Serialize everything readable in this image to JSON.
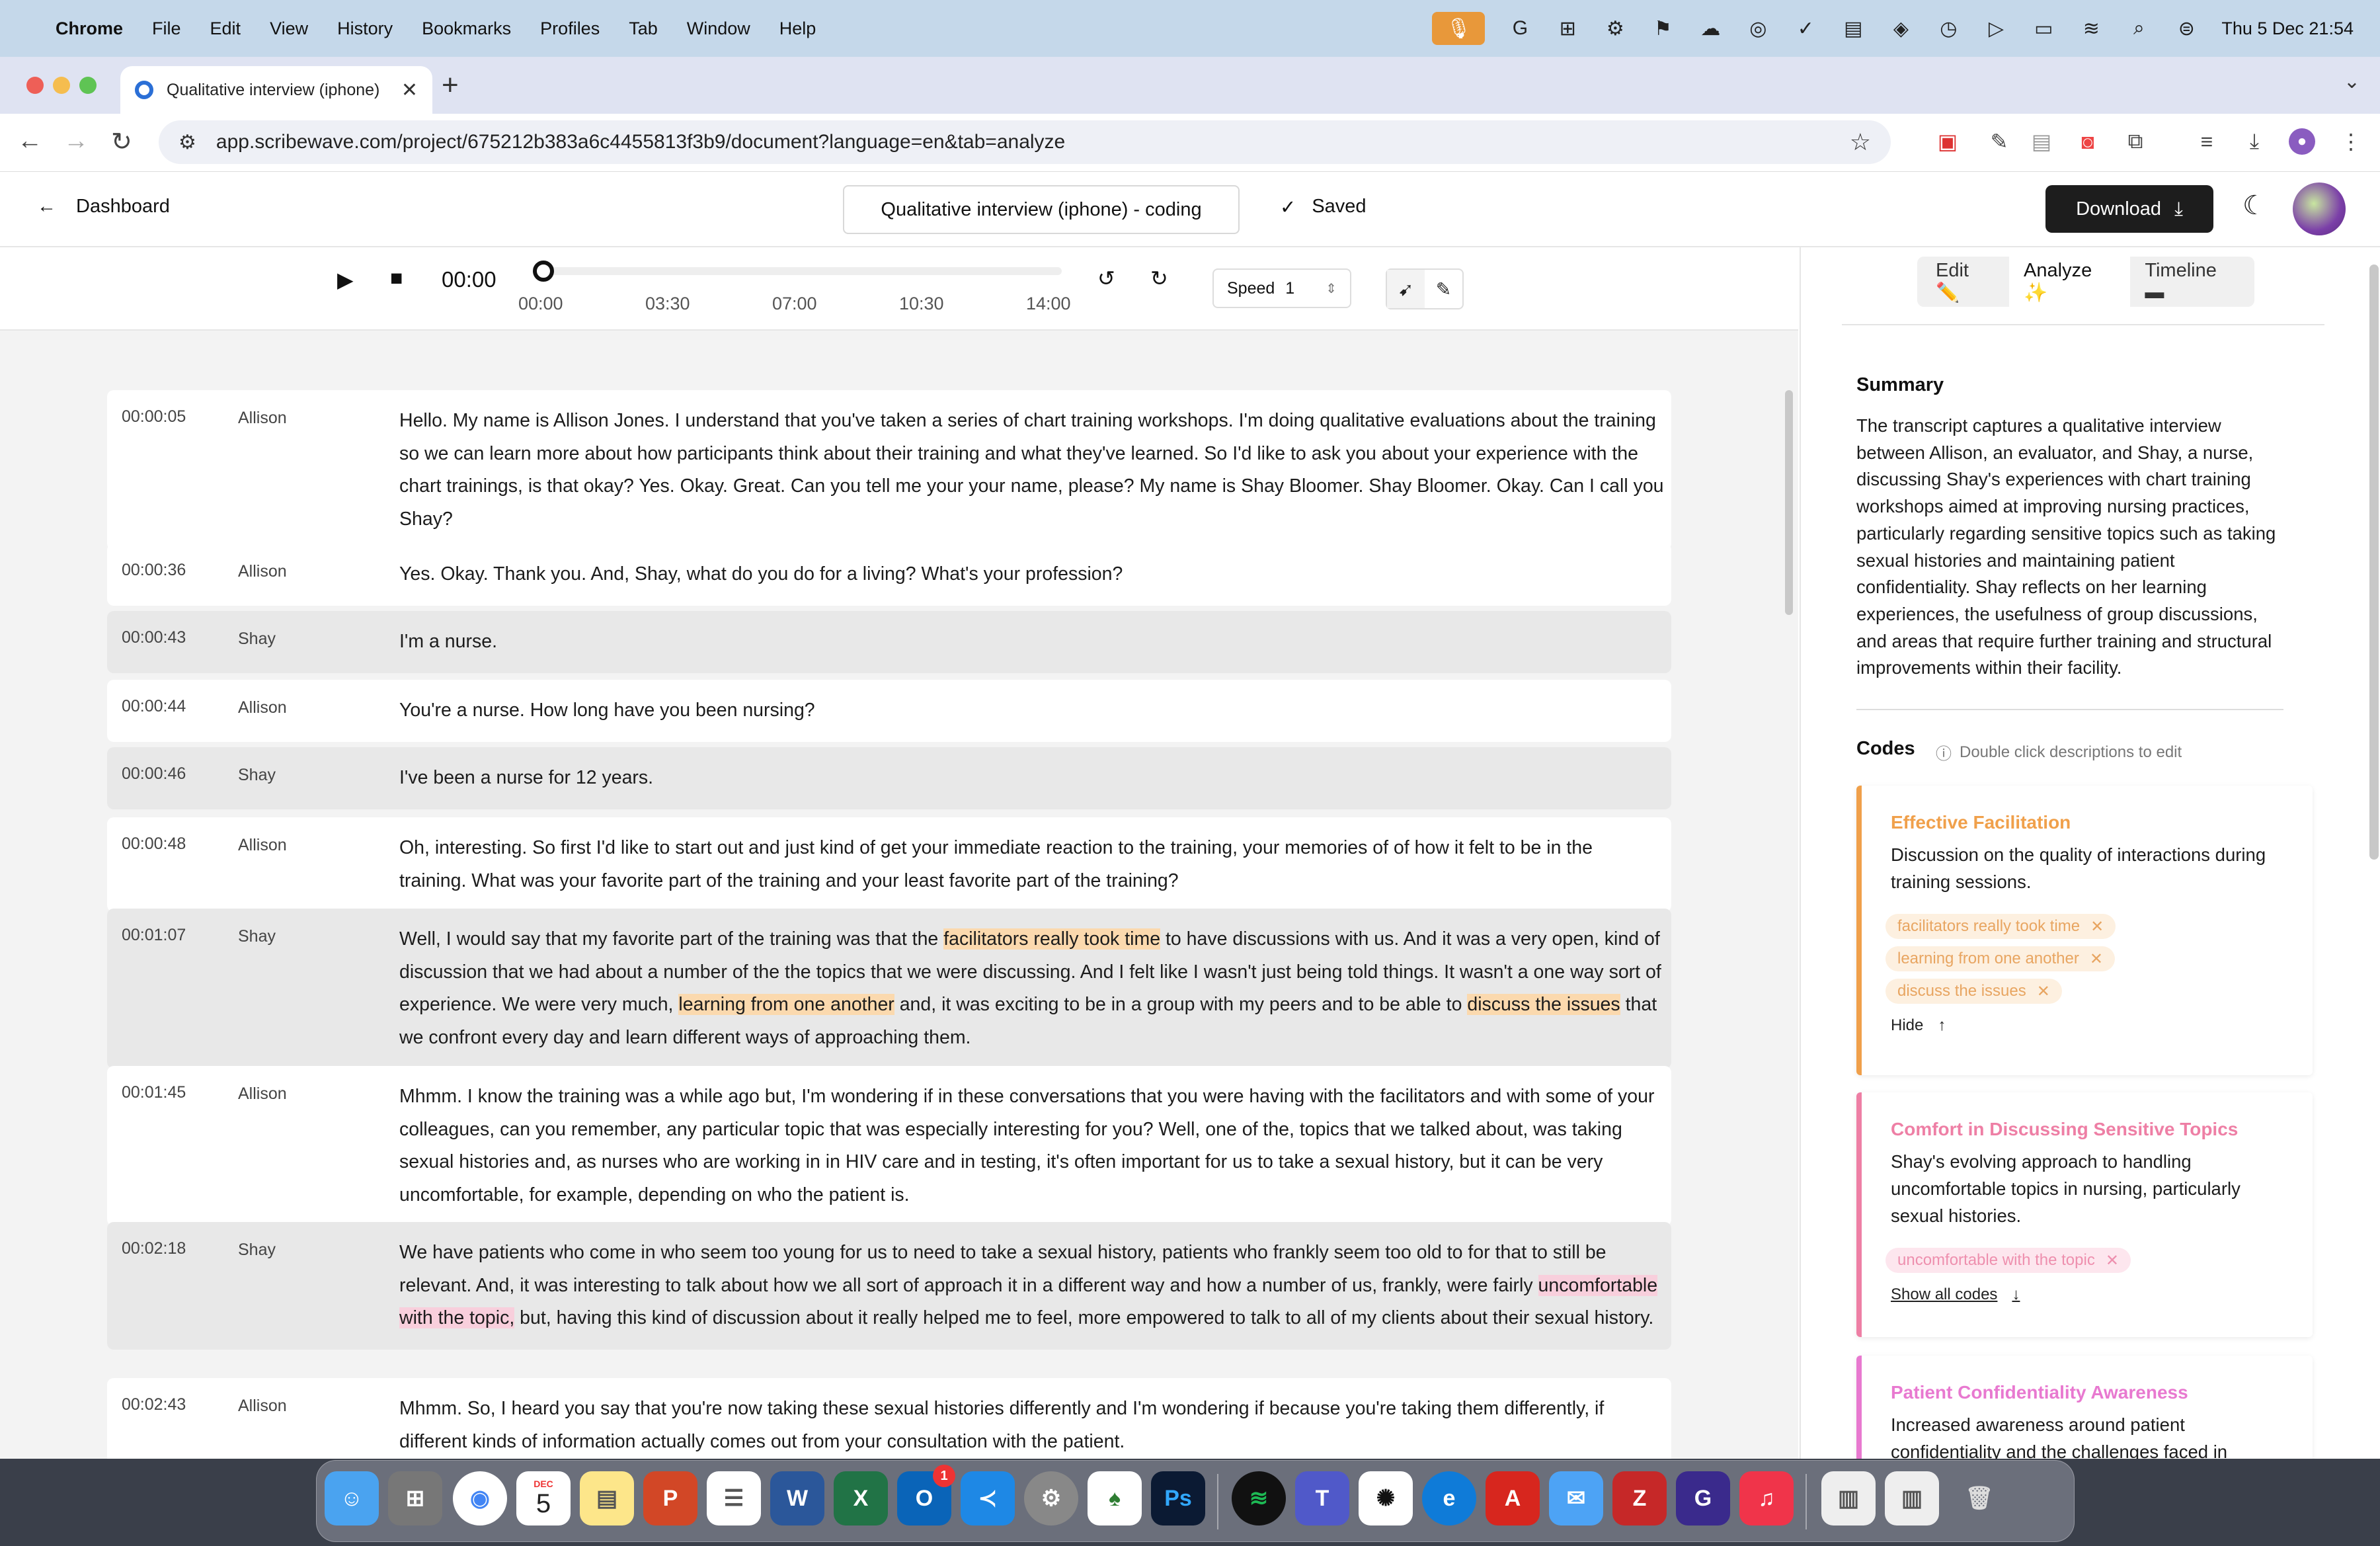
{
  "menubar": {
    "items": [
      "Chrome",
      "File",
      "Edit",
      "View",
      "History",
      "Bookmarks",
      "Profiles",
      "Tab",
      "Window",
      "Help"
    ],
    "datetime": "Thu 5 Dec  21:54"
  },
  "browser": {
    "tab_title": "Qualitative interview (iphone)",
    "url": "app.scribewave.com/project/675212b383a6c4455813f3b9/document?language=en&tab=analyze"
  },
  "app": {
    "back_label": "Dashboard",
    "doc_title": "Qualitative interview (iphone) - coding",
    "saved_label": "Saved",
    "download_label": "Download"
  },
  "player": {
    "time": "00:00",
    "ticks": [
      "00:00",
      "03:30",
      "07:00",
      "10:30",
      "14:00"
    ],
    "speed_label": "Speed",
    "speed_value": "1",
    "progress": 0
  },
  "transcript": [
    {
      "time": "00:00:05",
      "speaker": "Allison",
      "text": "Hello. My name is Allison Jones. I understand that you've taken a series of chart training workshops. I'm doing qualitative evaluations about the training so we can learn more about how participants think about their training and what they've learned. So I'd like to ask you about your experience with the chart trainings, is that okay? Yes. Okay. Great. Can you tell me your your name, please? My name is Shay Bloomer. Shay Bloomer. Okay. Can I call you Shay?"
    },
    {
      "time": "00:00:36",
      "speaker": "Allison",
      "text": "Yes. Okay. Thank you. And, Shay, what do you do for a living? What's your profession?"
    },
    {
      "time": "00:00:43",
      "speaker": "Shay",
      "text": "I'm a nurse."
    },
    {
      "time": "00:00:44",
      "speaker": "Allison",
      "text": "You're a nurse. How long have you been nursing?"
    },
    {
      "time": "00:00:46",
      "speaker": "Shay",
      "text": "I've been a nurse for 12 years."
    },
    {
      "time": "00:00:48",
      "speaker": "Allison",
      "text": "Oh, interesting. So first I'd like to start out and just kind of get your immediate reaction to the training, your memories of of how it felt to be in the training. What was your favorite part of the training and your least favorite part of the training?"
    },
    {
      "time": "00:01:07",
      "speaker": "Shay",
      "parts": [
        {
          "t": "Well, I would say that my favorite part of the training was that the "
        },
        {
          "t": "facilitators really took time",
          "h": "o"
        },
        {
          "t": " to have discussions with us. And it was a very open, kind of discussion that we had about a number of the the topics that we were discussing. And I felt like I wasn't just being told things. It wasn't a one way sort of experience. We were very much, "
        },
        {
          "t": "learning from one another",
          "h": "o"
        },
        {
          "t": " and, it was exciting to be in a group with my peers and to be able to "
        },
        {
          "t": "discuss the issues",
          "h": "o"
        },
        {
          "t": " that we confront every day and learn different ways of approaching them."
        }
      ]
    },
    {
      "time": "00:01:45",
      "speaker": "Allison",
      "text": "Mhmm. I know the training was a while ago but, I'm wondering if in these conversations that you were having with the facilitators and with some of your colleagues, can you remember, any particular topic that was especially interesting for you? Well, one of the, topics that we talked about, was taking sexual histories and, as nurses who are working in in HIV care and in testing, it's often important for us to take a sexual history, but it can be very uncomfortable, for example, depending on who the patient is."
    },
    {
      "time": "00:02:18",
      "speaker": "Shay",
      "parts": [
        {
          "t": "We have patients who come in who seem too young for us to need to take a sexual history, patients who frankly seem too old to for that to still be relevant. And, it was interesting to talk about how we all sort of approach it in a different way and how a number of us, frankly, were fairly "
        },
        {
          "t": "uncomfortable with the topic,",
          "h": "p"
        },
        {
          "t": " but, having this kind of discussion about it really helped me to feel, more empowered to talk to all of my clients about their sexual history."
        }
      ]
    },
    {
      "time": "00:02:43",
      "speaker": "Allison",
      "text": "Mhmm. So, I heard you say that you're now taking these sexual histories differently and I'm wondering if because you're taking them differently, if different kinds of information actually comes out from your consultation with the patient."
    }
  ],
  "panel": {
    "tabs": [
      {
        "label": "Edit",
        "icon": "✏️"
      },
      {
        "label": "Analyze",
        "icon": "✨"
      },
      {
        "label": "Timeline",
        "icon": "▬"
      }
    ],
    "active_tab": "Analyze",
    "summary_heading": "Summary",
    "summary": "The transcript captures a qualitative interview between Allison, an evaluator, and Shay, a nurse, discussing Shay's experiences with chart training workshops aimed at improving nursing practices, particularly regarding sensitive topics such as taking sexual histories and maintaining patient confidentiality. Shay reflects on her learning experiences, the usefulness of group discussions, and areas that require further training and structural improvements within their facility.",
    "codes_heading": "Codes",
    "codes_hint": "Double click descriptions to edit",
    "codes": [
      {
        "title": "Effective Facilitation",
        "color": "#f0a04b",
        "description": "Discussion on the quality of interactions during training sessions.",
        "tags": [
          "facilitators really took time",
          "learning from one another",
          "discuss the issues"
        ],
        "link": "Hide",
        "link_icon": "↑"
      },
      {
        "title": "Comfort in Discussing Sensitive Topics",
        "color": "#ee7fa5",
        "description": "Shay's evolving approach to handling uncomfortable topics in nursing, particularly sexual histories.",
        "tags": [
          "uncomfortable with the topic"
        ],
        "link": "Show all codes",
        "link_icon": "↓"
      },
      {
        "title": "Patient Confidentiality Awareness",
        "color": "#e879d0",
        "description": "Increased awareness around patient confidentiality and the challenges faced in",
        "tags": [],
        "link": "",
        "link_icon": ""
      }
    ]
  },
  "dock": {
    "calendar_month": "DEC",
    "calendar_day": "5",
    "outlook_badge": "1"
  }
}
